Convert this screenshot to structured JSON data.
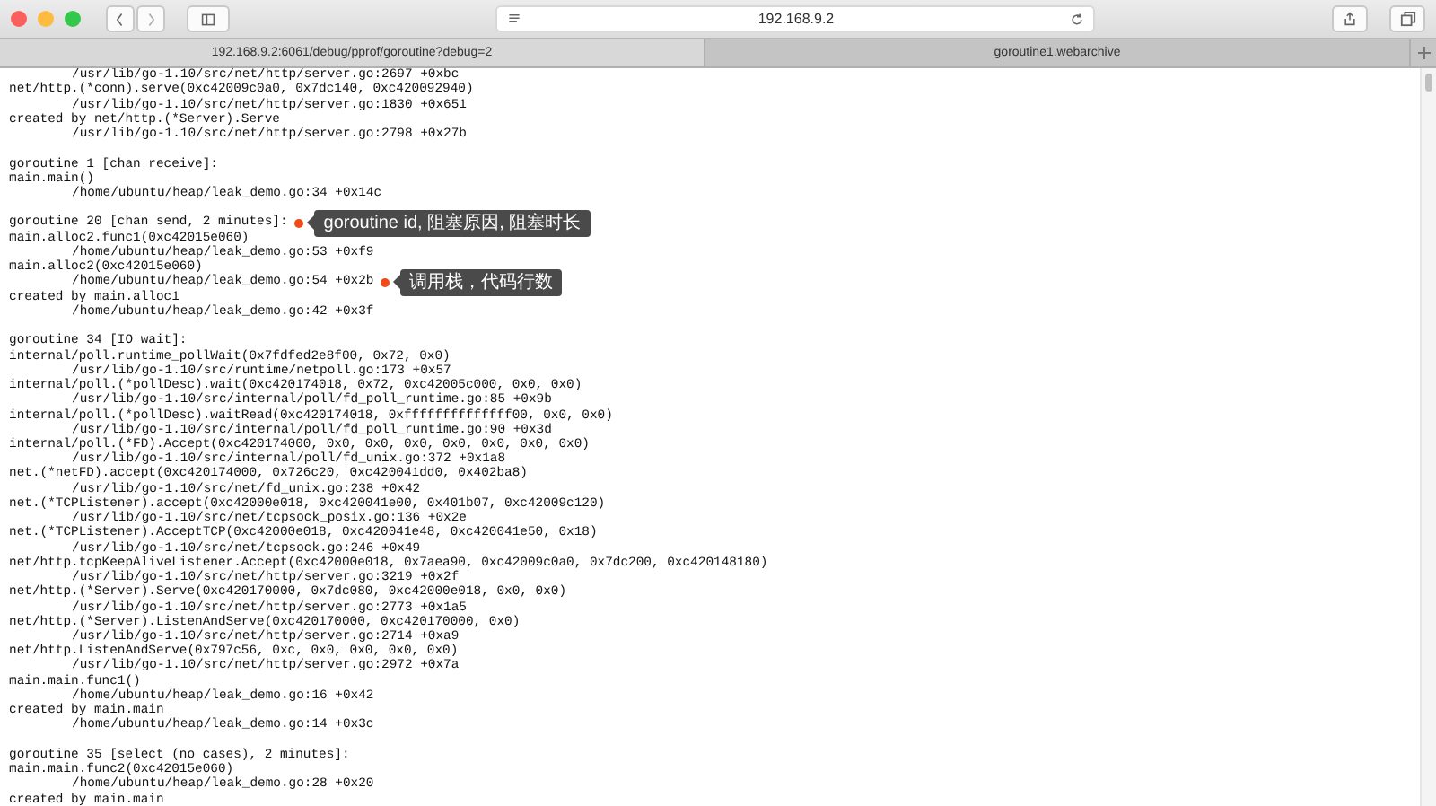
{
  "window": {
    "address": "192.168.9.2"
  },
  "tabs": [
    {
      "label": "192.168.9.2:6061/debug/pprof/goroutine?debug=2",
      "selected": true
    },
    {
      "label": "goroutine1.webarchive",
      "selected": false
    }
  ],
  "lines": [
    {
      "kind": "location",
      "text": "/usr/lib/go-1.10/src/net/http/server.go:2697 +0xbc"
    },
    {
      "kind": "call",
      "text": "net/http.(*conn).serve(0xc42009c0a0, 0x7dc140, 0xc420092940)"
    },
    {
      "kind": "location",
      "text": "/usr/lib/go-1.10/src/net/http/server.go:1830 +0x651"
    },
    {
      "kind": "call",
      "text": "created by net/http.(*Server).Serve"
    },
    {
      "kind": "location",
      "text": "/usr/lib/go-1.10/src/net/http/server.go:2798 +0x27b"
    },
    {
      "kind": "gap"
    },
    {
      "kind": "call",
      "text": "goroutine 1 [chan receive]:"
    },
    {
      "kind": "call",
      "text": "main.main()"
    },
    {
      "kind": "location",
      "text": "/home/ubuntu/heap/leak_demo.go:34 +0x14c"
    },
    {
      "kind": "gap"
    },
    {
      "kind": "call",
      "text": "goroutine 20 [chan send, 2 minutes]:",
      "note": "goroutine id, 阻塞原因, 阻塞时长"
    },
    {
      "kind": "call",
      "text": "main.alloc2.func1(0xc42015e060)"
    },
    {
      "kind": "location",
      "text": "/home/ubuntu/heap/leak_demo.go:53 +0xf9"
    },
    {
      "kind": "call",
      "text": "main.alloc2(0xc42015e060)"
    },
    {
      "kind": "location",
      "text": "/home/ubuntu/heap/leak_demo.go:54 +0x2b",
      "note": "调用栈，代码行数"
    },
    {
      "kind": "call",
      "text": "created by main.alloc1"
    },
    {
      "kind": "location",
      "text": "/home/ubuntu/heap/leak_demo.go:42 +0x3f"
    },
    {
      "kind": "gap"
    },
    {
      "kind": "call",
      "text": "goroutine 34 [IO wait]:"
    },
    {
      "kind": "call",
      "text": "internal/poll.runtime_pollWait(0x7fdfed2e8f00, 0x72, 0x0)"
    },
    {
      "kind": "location",
      "text": "/usr/lib/go-1.10/src/runtime/netpoll.go:173 +0x57"
    },
    {
      "kind": "call",
      "text": "internal/poll.(*pollDesc).wait(0xc420174018, 0x72, 0xc42005c000, 0x0, 0x0)"
    },
    {
      "kind": "location",
      "text": "/usr/lib/go-1.10/src/internal/poll/fd_poll_runtime.go:85 +0x9b"
    },
    {
      "kind": "call",
      "text": "internal/poll.(*pollDesc).waitRead(0xc420174018, 0xffffffffffffff00, 0x0, 0x0)"
    },
    {
      "kind": "location",
      "text": "/usr/lib/go-1.10/src/internal/poll/fd_poll_runtime.go:90 +0x3d"
    },
    {
      "kind": "call",
      "text": "internal/poll.(*FD).Accept(0xc420174000, 0x0, 0x0, 0x0, 0x0, 0x0, 0x0, 0x0)"
    },
    {
      "kind": "location",
      "text": "/usr/lib/go-1.10/src/internal/poll/fd_unix.go:372 +0x1a8"
    },
    {
      "kind": "call",
      "text": "net.(*netFD).accept(0xc420174000, 0x726c20, 0xc420041dd0, 0x402ba8)"
    },
    {
      "kind": "location",
      "text": "/usr/lib/go-1.10/src/net/fd_unix.go:238 +0x42"
    },
    {
      "kind": "call",
      "text": "net.(*TCPListener).accept(0xc42000e018, 0xc420041e00, 0x401b07, 0xc42009c120)"
    },
    {
      "kind": "location",
      "text": "/usr/lib/go-1.10/src/net/tcpsock_posix.go:136 +0x2e"
    },
    {
      "kind": "call",
      "text": "net.(*TCPListener).AcceptTCP(0xc42000e018, 0xc420041e48, 0xc420041e50, 0x18)"
    },
    {
      "kind": "location",
      "text": "/usr/lib/go-1.10/src/net/tcpsock.go:246 +0x49"
    },
    {
      "kind": "call",
      "text": "net/http.tcpKeepAliveListener.Accept(0xc42000e018, 0x7aea90, 0xc42009c0a0, 0x7dc200, 0xc420148180)"
    },
    {
      "kind": "location",
      "text": "/usr/lib/go-1.10/src/net/http/server.go:3219 +0x2f"
    },
    {
      "kind": "call",
      "text": "net/http.(*Server).Serve(0xc420170000, 0x7dc080, 0xc42000e018, 0x0, 0x0)"
    },
    {
      "kind": "location",
      "text": "/usr/lib/go-1.10/src/net/http/server.go:2773 +0x1a5"
    },
    {
      "kind": "call",
      "text": "net/http.(*Server).ListenAndServe(0xc420170000, 0xc420170000, 0x0)"
    },
    {
      "kind": "location",
      "text": "/usr/lib/go-1.10/src/net/http/server.go:2714 +0xa9"
    },
    {
      "kind": "call",
      "text": "net/http.ListenAndServe(0x797c56, 0xc, 0x0, 0x0, 0x0, 0x0)"
    },
    {
      "kind": "location",
      "text": "/usr/lib/go-1.10/src/net/http/server.go:2972 +0x7a"
    },
    {
      "kind": "call",
      "text": "main.main.func1()"
    },
    {
      "kind": "location",
      "text": "/home/ubuntu/heap/leak_demo.go:16 +0x42"
    },
    {
      "kind": "call",
      "text": "created by main.main"
    },
    {
      "kind": "location",
      "text": "/home/ubuntu/heap/leak_demo.go:14 +0x3c"
    },
    {
      "kind": "gap"
    },
    {
      "kind": "call",
      "text": "goroutine 35 [select (no cases), 2 minutes]:"
    },
    {
      "kind": "call",
      "text": "main.main.func2(0xc42015e060)"
    },
    {
      "kind": "location",
      "text": "/home/ubuntu/heap/leak_demo.go:28 +0x20"
    },
    {
      "kind": "call",
      "text": "created by main.main"
    }
  ]
}
